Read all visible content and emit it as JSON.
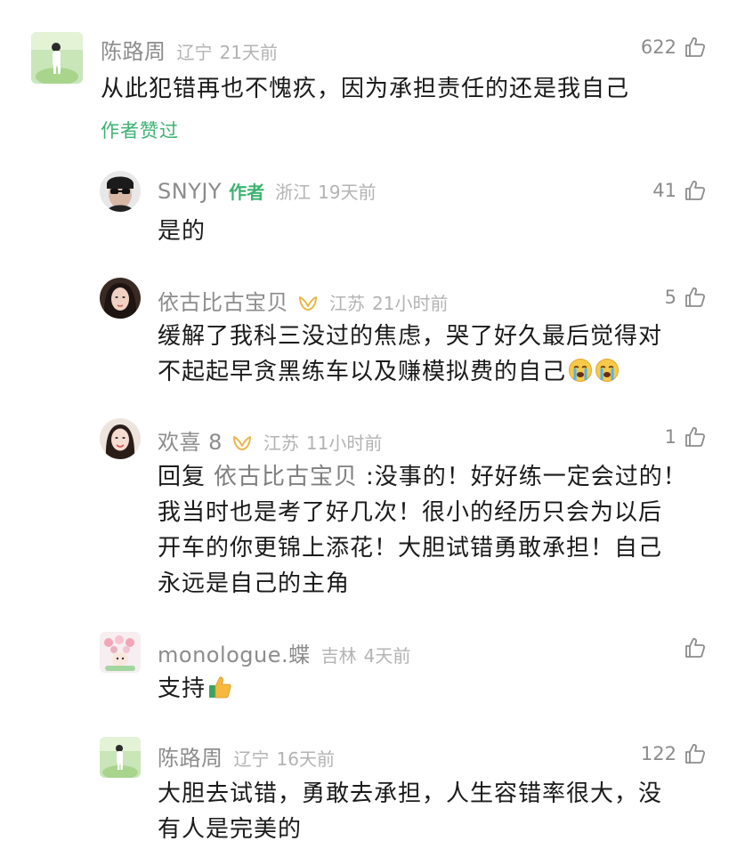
{
  "colors": {
    "author_green": "#3cb371",
    "nickname_gray": "#8c8c8c",
    "meta_gray": "#b3b3b3",
    "text_black": "#1a1a1a"
  },
  "comments": [
    {
      "nickname": "陈路周",
      "location": "辽宁",
      "time": "21天前",
      "likes": "622",
      "text": "从此犯错再也不愧疚，因为承担责任的还是我自己",
      "liked_by_author": "作者赞过",
      "avatar": "portrait-avatar-green"
    },
    {
      "nickname": "SNYJY",
      "author_tag": "作者",
      "location": "浙江",
      "time": "19天前",
      "likes": "41",
      "text": "是的",
      "avatar": "sunglasses-avatar"
    },
    {
      "nickname": "依古比古宝贝",
      "location": "江苏",
      "time": "21小时前",
      "likes": "5",
      "text_lines": [
        "缓解了我科三没过的焦虑，哭了好久最后觉得对",
        "不起起早贪黑练车以及赚模拟费的自己"
      ],
      "badge": "fan-badge-icon",
      "trailing_emoji": "loudly-crying-emoji",
      "avatar": "woman-avatar"
    },
    {
      "nickname": "欢喜 8",
      "location": "江苏",
      "time": "11小时前",
      "likes": "1",
      "reply_prefix": "回复",
      "reply_target": "依古比古宝贝",
      "reply_colon_text": ":没事的！好好练一定会过的！",
      "text_lines": [
        "我当时也是考了好几次！很小的经历只会为以后",
        "开车的你更锦上添花！大胆试错勇敢承担！自己",
        "永远是自己的主角"
      ],
      "badge": "fan-badge-icon",
      "avatar": "woman-avatar-2"
    },
    {
      "nickname": "monologue.蝶",
      "location": "吉林",
      "time": "4天前",
      "likes": "",
      "text": "支持",
      "trailing_emoji": "thumbs-up-emoji",
      "avatar": "flower-avatar"
    },
    {
      "nickname": "陈路周",
      "location": "辽宁",
      "time": "16天前",
      "likes": "122",
      "text_lines": [
        "大胆去试错，勇敢去承担，人生容错率很大，没",
        "有人是完美的"
      ],
      "avatar": "portrait-avatar-green"
    }
  ]
}
